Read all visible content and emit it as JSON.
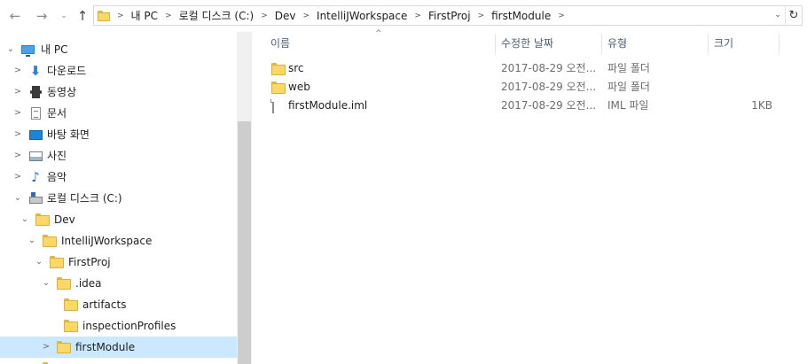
{
  "nav": {
    "back_icon": "←",
    "forward_icon": "→",
    "recent_icon": "⌄",
    "up_icon": "↑",
    "addr_drop_icon": "⌄",
    "refresh_icon": "↻",
    "breadcrumb": [
      "내 PC",
      "로컬 디스크 (C:)",
      "Dev",
      "IntelliJWorkspace",
      "FirstProj",
      "firstModule"
    ]
  },
  "tree": {
    "items": [
      {
        "label": "내 PC",
        "icon": "computer-icon",
        "expanded": true
      },
      {
        "label": "다운로드",
        "icon": "download-icon"
      },
      {
        "label": "동영상",
        "icon": "video-icon"
      },
      {
        "label": "문서",
        "icon": "document-icon"
      },
      {
        "label": "바탕 화면",
        "icon": "desktop-icon"
      },
      {
        "label": "사진",
        "icon": "pictures-icon"
      },
      {
        "label": "음악",
        "icon": "music-icon"
      },
      {
        "label": "로컬 디스크 (C:)",
        "icon": "drive-icon",
        "expanded": true
      },
      {
        "label": "Dev",
        "icon": "folder-icon",
        "expanded": true
      },
      {
        "label": "IntelliJWorkspace",
        "icon": "folder-icon",
        "expanded": true
      },
      {
        "label": "FirstProj",
        "icon": "folder-icon",
        "expanded": true
      },
      {
        "label": ".idea",
        "icon": "folder-icon",
        "expanded": true
      },
      {
        "label": "artifacts",
        "icon": "folder-icon"
      },
      {
        "label": "inspectionProfiles",
        "icon": "folder-icon"
      },
      {
        "label": "firstModule",
        "icon": "folder-icon",
        "selected": true
      }
    ]
  },
  "list": {
    "sort_icon": "^",
    "columns": {
      "name": "이름",
      "date": "수정한 날짜",
      "type": "유형",
      "size": "크기"
    },
    "rows": [
      {
        "name": "src",
        "date": "2017-08-29 오전...",
        "type": "파일 폴더",
        "size": "",
        "icon": "folder-icon"
      },
      {
        "name": "web",
        "date": "2017-08-29 오전...",
        "type": "파일 폴더",
        "size": "",
        "icon": "folder-icon"
      },
      {
        "name": "firstModule.iml",
        "date": "2017-08-29 오전...",
        "type": "IML 파일",
        "size": "1KB",
        "icon": "file-icon"
      }
    ]
  }
}
